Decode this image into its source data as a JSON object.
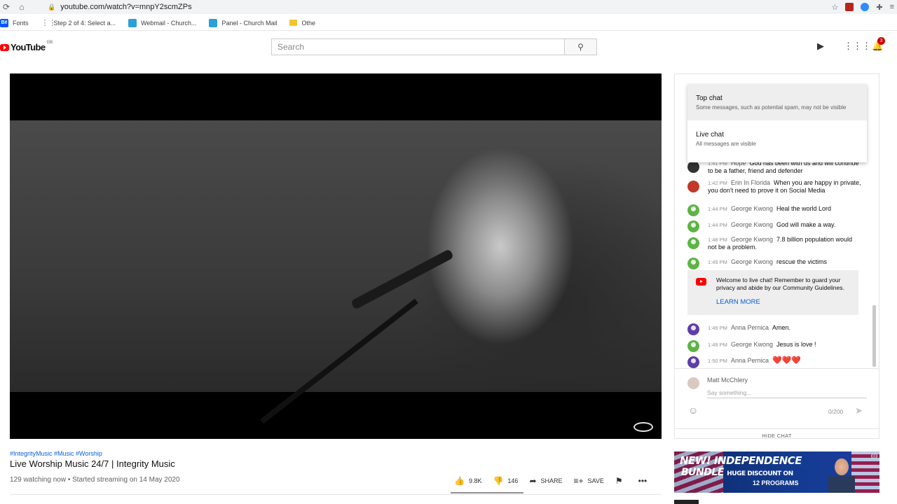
{
  "browser": {
    "url": "youtube.com/watch?v=mnpY2scmZPs",
    "bookmarks": [
      {
        "label": "Fonts",
        "icon": "behance-icon"
      },
      {
        "label": "Step 2 of 4: Select a...",
        "icon": "apps-grid-icon"
      },
      {
        "label": "Webmail - Church...",
        "icon": "webmail-icon"
      },
      {
        "label": "Panel - Church Mail",
        "icon": "webmail-icon"
      }
    ],
    "other_bookmarks": "Othe"
  },
  "header": {
    "logo_text": "YouTube",
    "region": "GB",
    "search_placeholder": "Search",
    "notification_count": "3"
  },
  "video": {
    "tags": "#IntegrityMusic #Music #Worship",
    "title": "Live Worship Music 24/7 | Integrity Music",
    "meta": "129 watching now • Started streaming on 14 May 2020",
    "likes": "9.8K",
    "dislikes": "146",
    "share_label": "SHARE",
    "save_label": "SAVE"
  },
  "chat": {
    "dropdown": [
      {
        "title": "Top chat",
        "sub": "Some messages, such as potential spam, may not be visible"
      },
      {
        "title": "Live chat",
        "sub": "All messages are visible"
      }
    ],
    "messages": [
      {
        "time": "1:41 PM",
        "author": "Hope",
        "text": "God has been with us and will continue to be a father, friend and defender"
      },
      {
        "time": "1:42 PM",
        "author": "Erin In Florida",
        "text": "When you are happy in private, you don't need to prove it on Social Media"
      },
      {
        "time": "1:44 PM",
        "author": "George Kwong",
        "text": "Heal the world Lord"
      },
      {
        "time": "1:44 PM",
        "author": "George Kwong",
        "text": "God will make a way."
      },
      {
        "time": "1:48 PM",
        "author": "George Kwong",
        "text": "7.8 billion population would not be a problem."
      },
      {
        "time": "1:49 PM",
        "author": "George Kwong",
        "text": "rescue the victims"
      },
      {
        "time": "1:49 PM",
        "author": "Anna Pernica",
        "text": "Amen."
      },
      {
        "time": "1:49 PM",
        "author": "George Kwong",
        "text": "Jesus is love !"
      },
      {
        "time": "1:50 PM",
        "author": "Anna Pernica",
        "text": "❤️❤️❤️"
      }
    ],
    "welcome_text": "Welcome to live chat! Remember to guard your privacy and abide by our Community Guidelines.",
    "learn_more": "LEARN MORE",
    "user_name": "Matt McChlery",
    "input_placeholder": "Say something...",
    "counter": "0/200",
    "hide_chat": "HIDE CHAT"
  },
  "ad": {
    "line1": "NEW! INDEPENDENCE",
    "line2": "BUNDLE",
    "line2_sub": "HUGE DISCOUNT ON",
    "line3": "12 PROGRAMS"
  }
}
